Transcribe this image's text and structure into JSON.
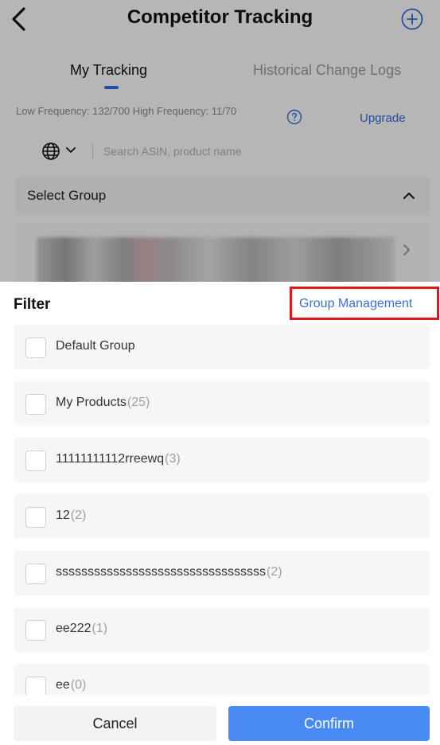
{
  "header": {
    "title": "Competitor Tracking",
    "back_icon": "chevron-left-icon",
    "add_icon": "plus-circle-icon"
  },
  "tabs": [
    {
      "label": "My Tracking",
      "active": true
    },
    {
      "label": "Historical Change Logs",
      "active": false
    }
  ],
  "frequency": {
    "text": "Low Frequency: 132/700 High Frequency: 11/70",
    "help_icon": "question-circle-icon",
    "upgrade_label": "Upgrade"
  },
  "search": {
    "placeholder": "Search ASIN, product name",
    "value": "",
    "marketplace_icon": "globe-icon"
  },
  "select_group": {
    "label": "Select Group",
    "chevron_icon": "chevron-up-icon"
  },
  "filter": {
    "title": "Filter",
    "group_management_label": "Group Management",
    "groups": [
      {
        "name": "Default Group",
        "count": ""
      },
      {
        "name": "My Products",
        "count": "(25)"
      },
      {
        "name": "11111111112rreewq",
        "count": "(3)"
      },
      {
        "name": "12",
        "count": "(2)"
      },
      {
        "name": "sssssssssssssssssssssssssssssssss",
        "count": "(2)"
      },
      {
        "name": "ee222",
        "count": "(1)"
      },
      {
        "name": "ee",
        "count": "(0)"
      }
    ],
    "cancel_label": "Cancel",
    "confirm_label": "Confirm"
  },
  "colors": {
    "accent": "#2e6be6",
    "confirm_button": "#4a8af4",
    "highlight_border": "#e0161b"
  }
}
